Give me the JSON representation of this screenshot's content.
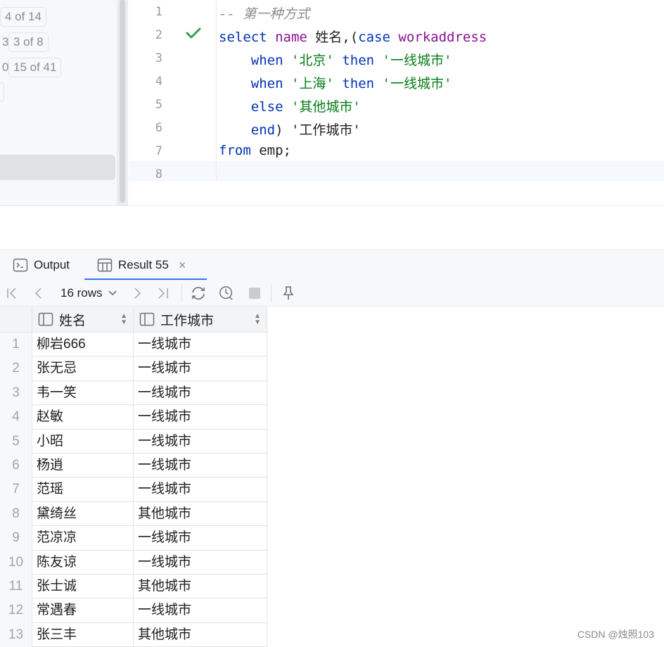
{
  "left_panel": {
    "badges": [
      {
        "text": "4 of 14",
        "prefix": ""
      },
      {
        "text": "3 of 8",
        "prefix": "3"
      },
      {
        "text": "15 of 41",
        "prefix": "0"
      }
    ]
  },
  "editor": {
    "line_numbers": [
      "1",
      "2",
      "3",
      "4",
      "5",
      "6",
      "7",
      "8"
    ],
    "lines": [
      [
        {
          "t": "-- 第一种方式",
          "c": "cmt"
        }
      ],
      [
        {
          "t": "select ",
          "c": "kw"
        },
        {
          "t": "name",
          "c": "fld"
        },
        {
          "t": " 姓名,(",
          "c": ""
        },
        {
          "t": "case ",
          "c": "kw"
        },
        {
          "t": "workaddress",
          "c": "fld"
        }
      ],
      [
        {
          "t": "    ",
          "c": ""
        },
        {
          "t": "when ",
          "c": "kw"
        },
        {
          "t": "'北京'",
          "c": "str"
        },
        {
          "t": " ",
          "c": ""
        },
        {
          "t": "then ",
          "c": "kw"
        },
        {
          "t": "'一线城市'",
          "c": "str"
        }
      ],
      [
        {
          "t": "    ",
          "c": ""
        },
        {
          "t": "when ",
          "c": "kw"
        },
        {
          "t": "'上海'",
          "c": "str"
        },
        {
          "t": " ",
          "c": ""
        },
        {
          "t": "then ",
          "c": "kw"
        },
        {
          "t": "'一线城市'",
          "c": "str"
        }
      ],
      [
        {
          "t": "    ",
          "c": ""
        },
        {
          "t": "else ",
          "c": "kw"
        },
        {
          "t": "'其他城市'",
          "c": "str"
        }
      ],
      [
        {
          "t": "    ",
          "c": ""
        },
        {
          "t": "end",
          "c": "kw"
        },
        {
          "t": ") '工作城市'",
          "c": ""
        }
      ],
      [
        {
          "t": "from ",
          "c": "kw"
        },
        {
          "t": "emp;",
          "c": ""
        }
      ],
      [
        {
          "t": "",
          "c": ""
        }
      ]
    ]
  },
  "tabs": [
    {
      "label": "Output",
      "icon": "console-icon"
    },
    {
      "label": "Result 55",
      "icon": "table-icon",
      "close": "×"
    }
  ],
  "toolbar": {
    "rows_label": "16 rows",
    "chevron": "⌄"
  },
  "table": {
    "columns": [
      "姓名",
      "工作城市"
    ],
    "rows": [
      [
        "1",
        "柳岩666",
        "一线城市"
      ],
      [
        "2",
        "张无忌",
        "一线城市"
      ],
      [
        "3",
        "韦一笑",
        "一线城市"
      ],
      [
        "4",
        "赵敏",
        "一线城市"
      ],
      [
        "5",
        "小昭",
        "一线城市"
      ],
      [
        "6",
        "杨逍",
        "一线城市"
      ],
      [
        "7",
        "范瑶",
        "一线城市"
      ],
      [
        "8",
        "黛绮丝",
        "其他城市"
      ],
      [
        "9",
        "范凉凉",
        "一线城市"
      ],
      [
        "10",
        "陈友谅",
        "一线城市"
      ],
      [
        "11",
        "张士诚",
        "其他城市"
      ],
      [
        "12",
        "常遇春",
        "一线城市"
      ],
      [
        "13",
        "张三丰",
        "其他城市"
      ]
    ]
  },
  "watermark": "CSDN @烛照103",
  "colors": {
    "accent": "#3574f0",
    "keyword": "#0033b3",
    "string": "#067d17",
    "field": "#871094"
  }
}
